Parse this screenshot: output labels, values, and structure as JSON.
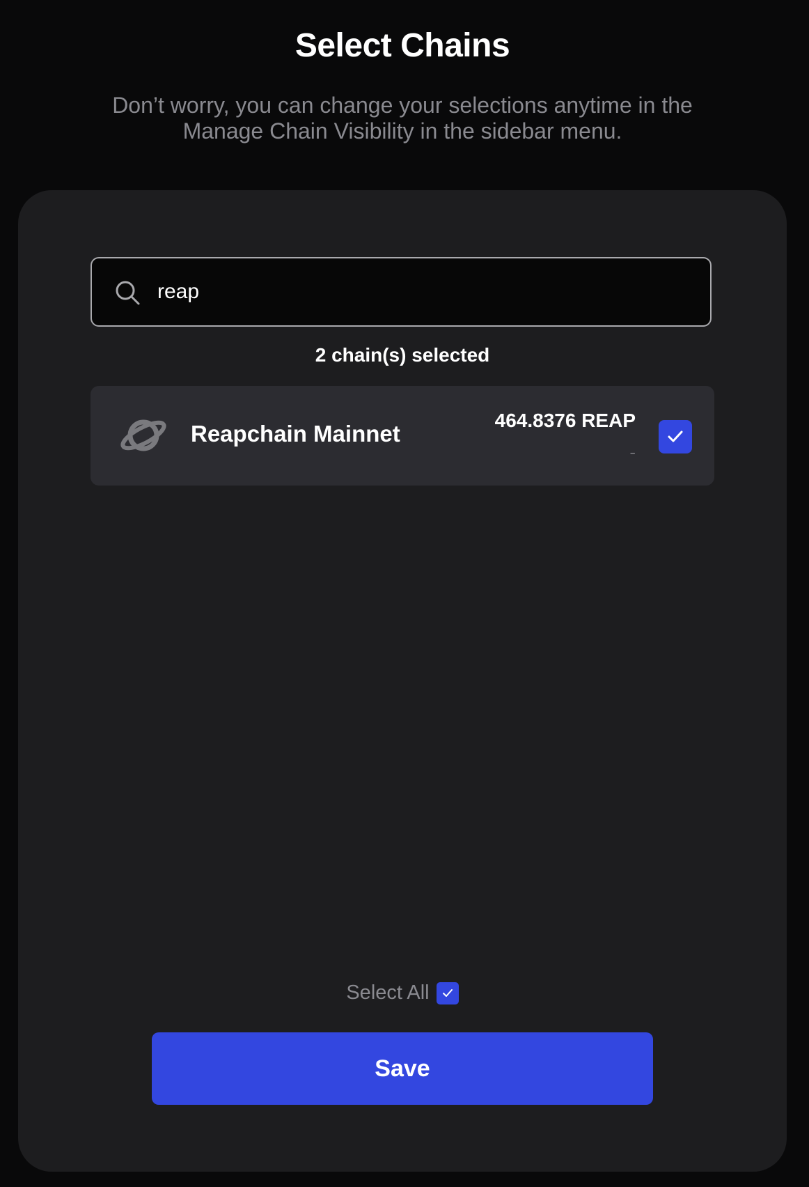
{
  "header": {
    "title": "Select Chains",
    "subtitle_line1": "Don’t worry, you can change your selections anytime in the",
    "subtitle_line2": "Manage Chain Visibility in the sidebar menu."
  },
  "search": {
    "value": "reap",
    "icon": "search-icon"
  },
  "selection": {
    "count_text": "2 chain(s) selected"
  },
  "chains": [
    {
      "name": "Reapchain Mainnet",
      "balance": "464.8376 REAP",
      "value": "-",
      "icon": "planet-icon",
      "checked": true
    }
  ],
  "footer": {
    "select_all_label": "Select All",
    "select_all_checked": true,
    "save_label": "Save"
  },
  "colors": {
    "background": "#09090a",
    "panel": "#1d1d1f",
    "row": "#2c2c31",
    "accent": "#3347e0",
    "muted_text": "#8a8a90"
  }
}
